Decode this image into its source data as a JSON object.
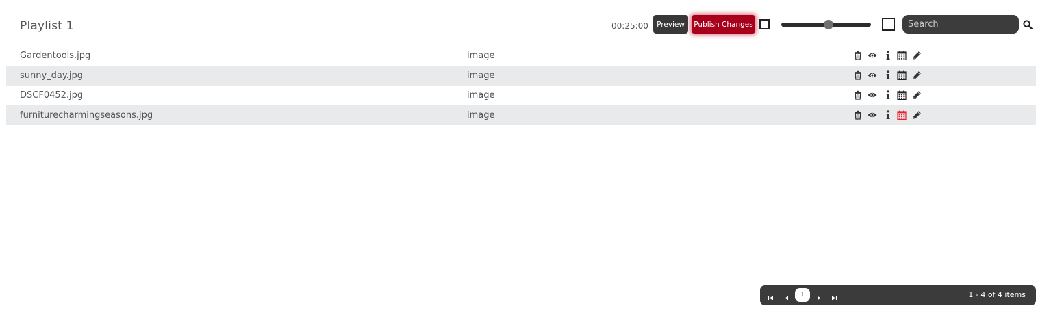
{
  "header": {
    "title": "Playlist 1",
    "duration": "00:25:00",
    "preview_label": "Preview",
    "publish_label": "Publish Changes",
    "search_placeholder": "Search",
    "slider_level": 0.5
  },
  "rows": [
    {
      "name": "Gardentools.jpg",
      "type": "image",
      "calendar_color": "#222222"
    },
    {
      "name": "sunny_day.jpg",
      "type": "image",
      "calendar_color": "#222222"
    },
    {
      "name": "DSCF0452.jpg",
      "type": "image",
      "calendar_color": "#222222"
    },
    {
      "name": "furniturecharmingseasons.jpg",
      "type": "image",
      "calendar_color": "#e8202a"
    }
  ],
  "row_icons": [
    "trash-icon",
    "eye-icon",
    "info-icon",
    "calendar-icon",
    "pencil-icon"
  ],
  "pager": {
    "current_page": "1",
    "info": "1 - 4 of 4 items"
  },
  "colors": {
    "accent": "#a8001a",
    "dark": "#383838",
    "row_alt": "#e9eaec"
  }
}
